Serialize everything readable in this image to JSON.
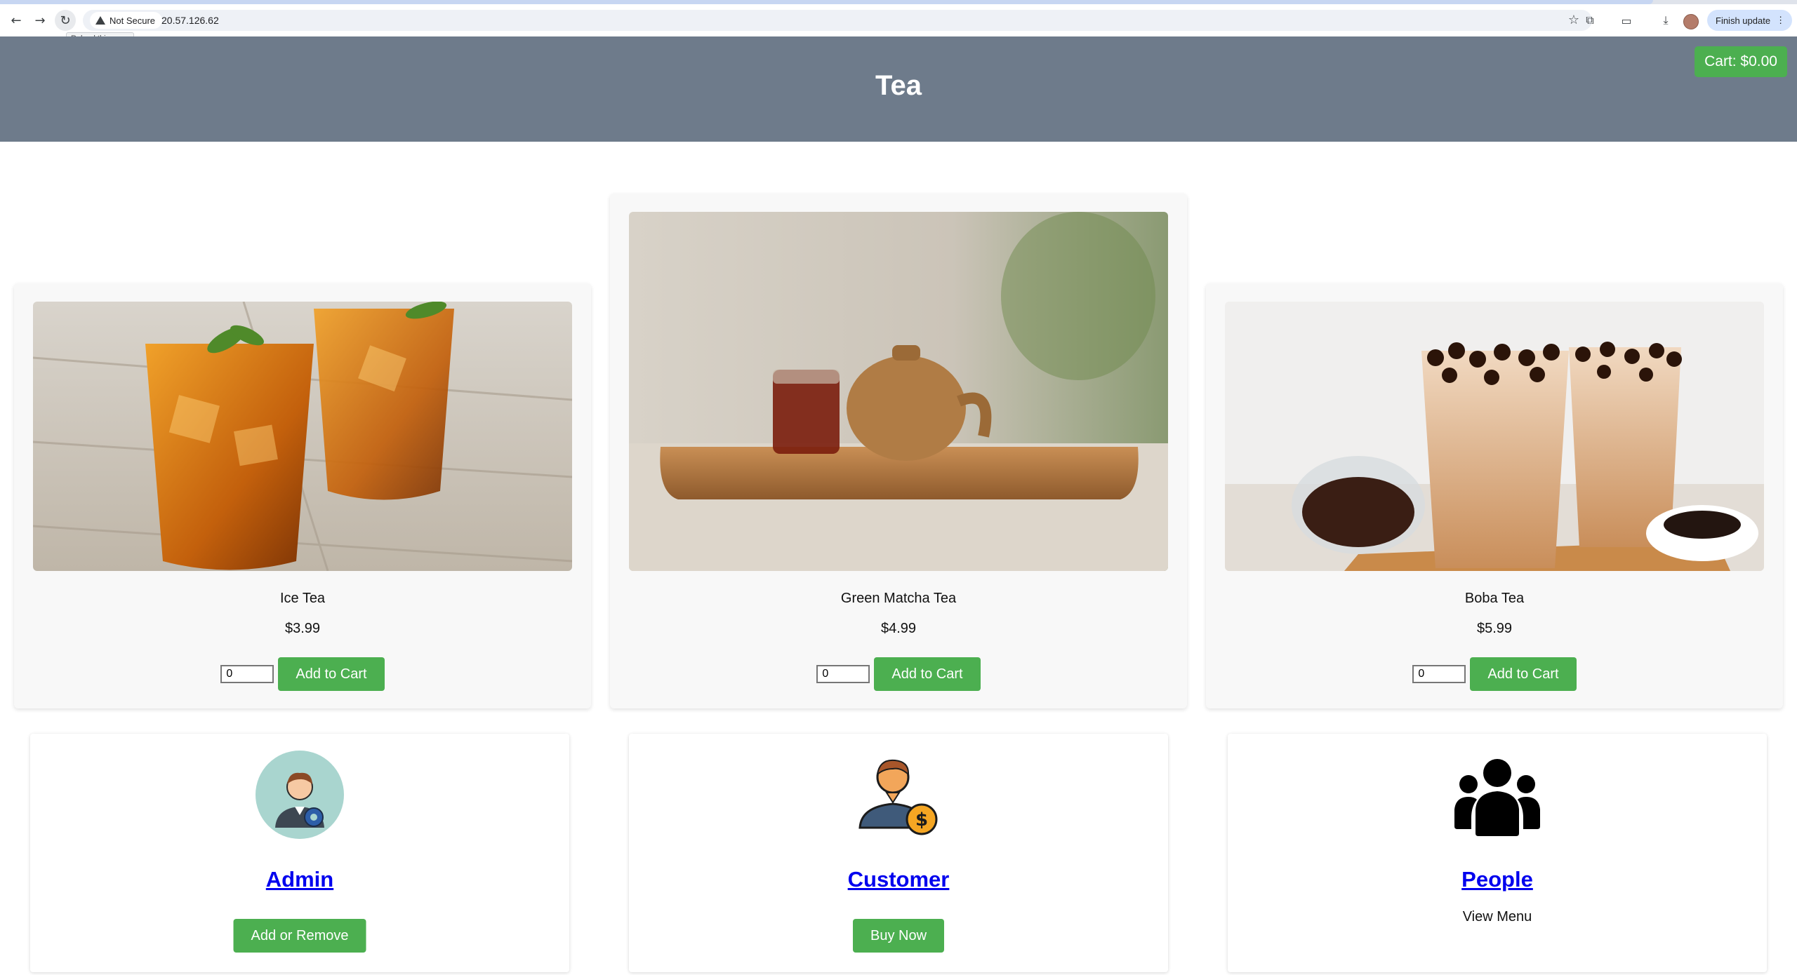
{
  "browser": {
    "security_label": "Not Secure",
    "url": "20.57.126.62",
    "tooltip": "Reload this page",
    "update_label": "Finish update"
  },
  "header": {
    "title": "Tea",
    "cart_label": "Cart: $0.00"
  },
  "products": [
    {
      "name": "Ice Tea",
      "price": "$3.99",
      "qty": "0",
      "button": "Add to Cart"
    },
    {
      "name": "Green Matcha Tea",
      "price": "$4.99",
      "qty": "0",
      "button": "Add to Cart"
    },
    {
      "name": "Boba Tea",
      "price": "$5.99",
      "qty": "0",
      "button": "Add to Cart"
    }
  ],
  "roles": [
    {
      "title": "Admin",
      "button": "Add or Remove"
    },
    {
      "title": "Customer",
      "button": "Buy Now"
    },
    {
      "title": "People",
      "text": "View Menu"
    }
  ],
  "icons": {
    "back": "back-arrow-icon",
    "forward": "forward-arrow-icon",
    "reload": "reload-icon",
    "security": "warning-icon",
    "bookmark": "star-icon",
    "admin": "admin-gear-person-icon",
    "customer": "customer-dollar-icon",
    "people": "group-people-icon"
  },
  "colors": {
    "header_bg": "#6e7b8b",
    "accent_green": "#4caf50",
    "link_blue": "#0000ee"
  }
}
